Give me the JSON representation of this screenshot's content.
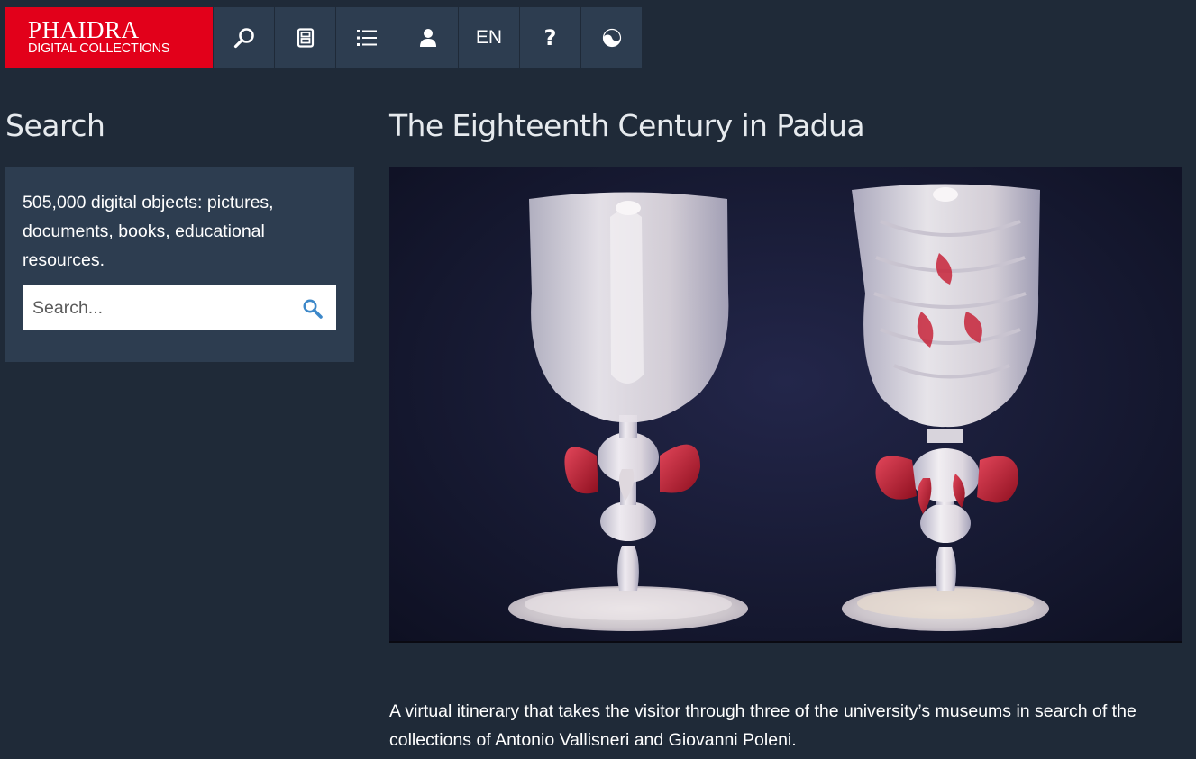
{
  "header": {
    "logo_line1": "PHAIDRA",
    "logo_line2": "DIGITAL COLLECTIONS",
    "brand_color": "#e2001a",
    "nav_icons": [
      "search-icon",
      "archive-icon",
      "list-icon",
      "user-icon",
      "language",
      "help-icon",
      "theme-toggle-icon"
    ],
    "language_label": "EN",
    "help_label": "?"
  },
  "sidebar": {
    "title": "Search",
    "description": "505,000 digital objects: pictures, documents, books, educational resources.",
    "search_placeholder": "Search..."
  },
  "main": {
    "title": "The Eighteenth Century in Padua",
    "description": "A virtual itinerary that takes the visitor through three of the university’s museums in search of the collections of Antonio Vallisneri and Giovanni Poleni."
  },
  "colors": {
    "page_background": "#1f2a38",
    "panel_background": "#2d3d50",
    "search_icon": "#3d88c9"
  }
}
